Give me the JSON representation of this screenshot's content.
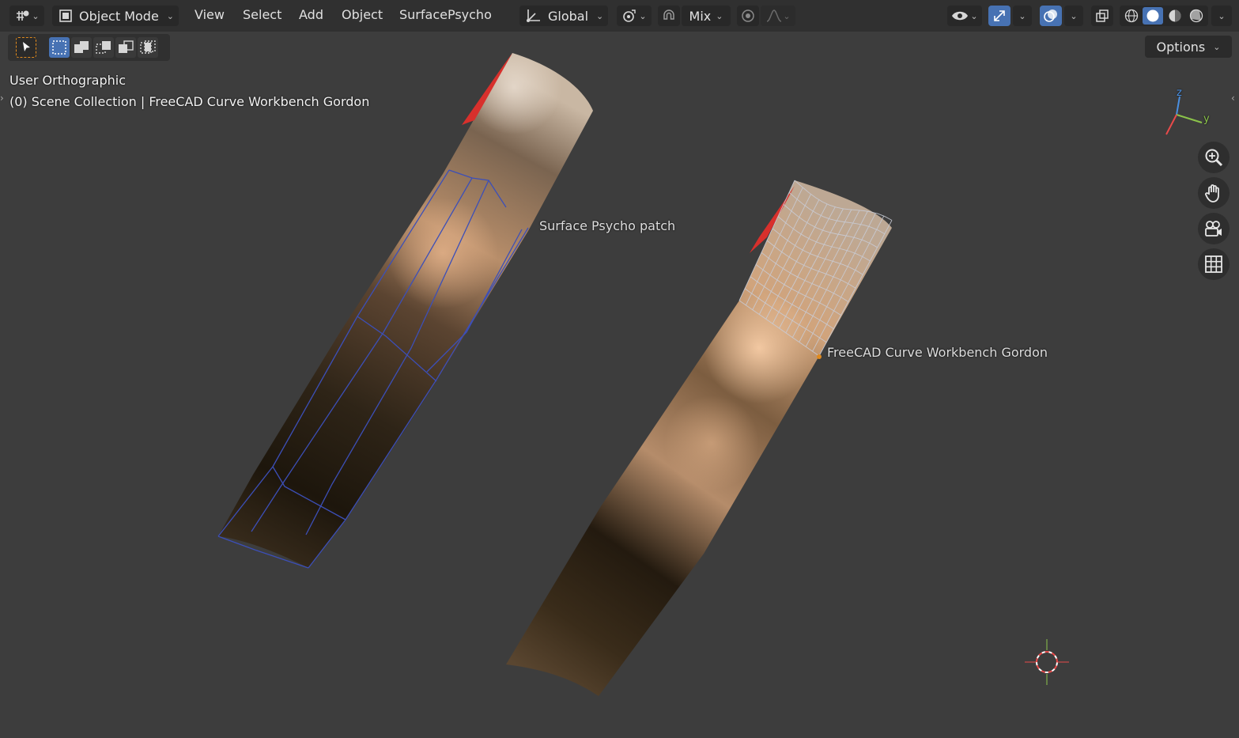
{
  "header": {
    "mode_label": "Object Mode",
    "menus": [
      "View",
      "Select",
      "Add",
      "Object",
      "SurfacePsycho"
    ],
    "orientation_label": "Global",
    "snap_mode_label": "Mix"
  },
  "toolbar": {
    "options_label": "Options"
  },
  "viewport": {
    "view_name": "User Orthographic",
    "collection_info": "(0) Scene Collection | FreeCAD Curve Workbench Gordon",
    "labels": {
      "surface_psycho": "Surface Psycho patch",
      "freecad_gordon": "FreeCAD Curve Workbench Gordon"
    },
    "axis_labels": {
      "z": "z",
      "y": "y"
    }
  },
  "colors": {
    "header_bg": "#303030",
    "viewport_bg": "#3d3d3d",
    "accent_blue": "#4772b3",
    "select_outline": "#e08a1e",
    "axis_y": "#8bc34a",
    "axis_z": "#4a90e2",
    "axis_x": "#e84a4a"
  }
}
